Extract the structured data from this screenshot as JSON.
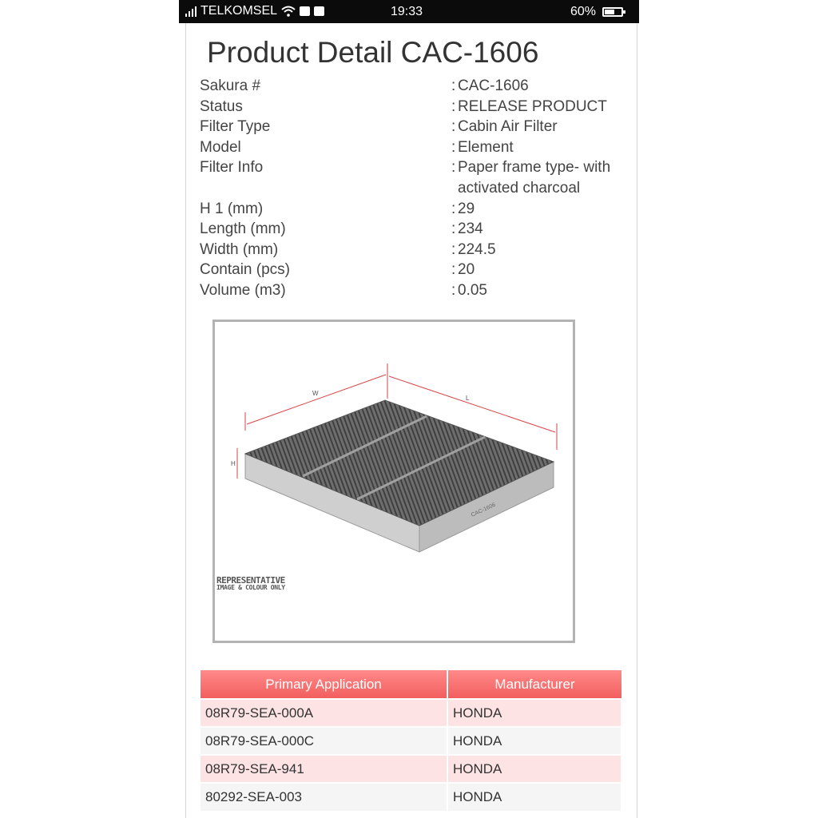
{
  "status_bar": {
    "carrier": "TELKOMSEL",
    "time": "19:33",
    "battery": "60%",
    "battery_level": 0.6
  },
  "page": {
    "title": "Product Detail CAC-1606"
  },
  "specs": [
    {
      "label": "Sakura #",
      "sep": ":",
      "value": "CAC-1606"
    },
    {
      "label": "Status",
      "sep": ":",
      "value": "RELEASE PRODUCT"
    },
    {
      "label": "Filter Type",
      "sep": ":",
      "value": "Cabin Air Filter"
    },
    {
      "label": "Model",
      "sep": ":",
      "value": "Element"
    },
    {
      "label": "Filter Info",
      "sep": ":",
      "value": "Paper frame type- with activated charcoal"
    },
    {
      "label": "H 1 (mm)",
      "sep": ":",
      "value": "29"
    },
    {
      "label": "Length (mm)",
      "sep": ":",
      "value": "234"
    },
    {
      "label": "Width (mm)",
      "sep": ":",
      "value": "224.5"
    },
    {
      "label": "Contain (pcs)",
      "sep": ":",
      "value": "20"
    },
    {
      "label": "Volume (m3)",
      "sep": ":",
      "value": "0.05"
    }
  ],
  "image": {
    "dim_w": "W",
    "dim_l": "L",
    "dim_h": "H",
    "part_mark": "CAC-1606",
    "note_line1": "REPRESENTATIVE",
    "note_line2": "IMAGE & COLOUR ONLY"
  },
  "table": {
    "headers": [
      "Primary Application",
      "Manufacturer"
    ],
    "rows": [
      [
        "08R79-SEA-000A",
        "HONDA"
      ],
      [
        "08R79-SEA-000C",
        "HONDA"
      ],
      [
        "08R79-SEA-941",
        "HONDA"
      ],
      [
        "80292-SEA-003",
        "HONDA"
      ]
    ]
  },
  "colors": {
    "header_gradient_top": "#ff8a8a",
    "header_gradient_bottom": "#f35e5e",
    "row_odd": "#fde3e3",
    "row_even": "#f5f5f5",
    "dimension_lines": "#d94545"
  }
}
